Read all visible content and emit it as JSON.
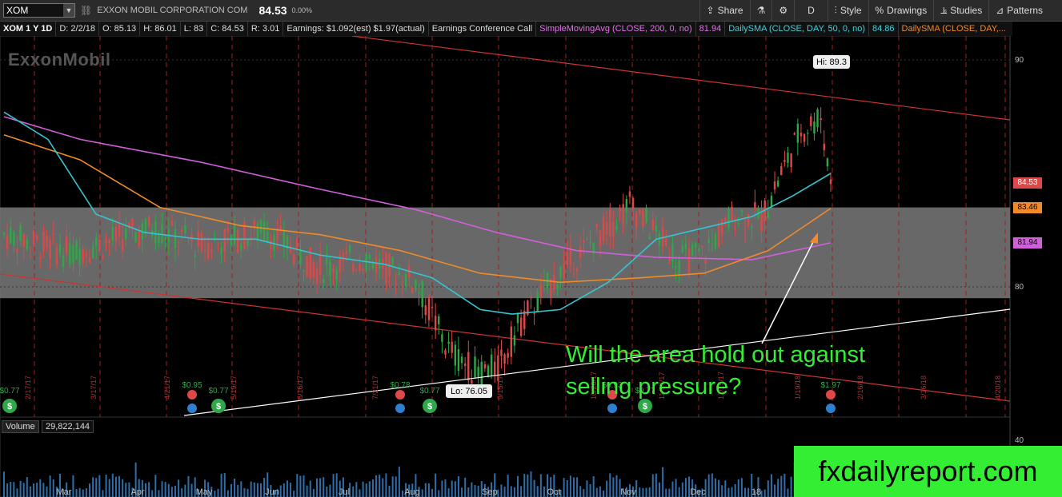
{
  "toolbar": {
    "symbol": "XOM",
    "company": "EXXON MOBIL CORPORATION COM",
    "last_price": "84.53",
    "pct_change": "0.00%",
    "share": "Share",
    "aggregation": "D",
    "style": "Style",
    "drawings": "Drawings",
    "studies": "Studies",
    "patterns": "Patterns"
  },
  "infobar": {
    "title": "XOM 1 Y 1D",
    "date": "D: 2/2/18",
    "open": "O: 85.13",
    "high": "H: 86.01",
    "low": "L: 83",
    "close": "C: 84.53",
    "range": "R: 3.01",
    "earnings": "Earnings: $1.092(est) $1.97(actual)",
    "conf": "Earnings Conference Call",
    "sma200_label": "SimpleMovingAvg (CLOSE, 200, 0, no)",
    "sma200_val": "81.94",
    "sma50_label": "DailySMA (CLOSE, DAY, 50, 0, no)",
    "sma50_val": "84.86",
    "sma100_label": "DailySMA (CLOSE, DAY,..."
  },
  "logo_text": "ExxonMobil",
  "annotation": "Will the area hold out against selling pressure?",
  "watermark": "fxdailyreport.com",
  "volume": {
    "label": "Volume",
    "value": "29,822,144",
    "axis_max": "40"
  },
  "colors": {
    "up": "#2ea84a",
    "down": "#e04848",
    "sma50": "#36c5d0",
    "sma100": "#f08a2a",
    "sma200": "#d060d8",
    "zone": "#7a7a7a",
    "channel": "#cc3333",
    "trendline": "#ffffff",
    "annotation": "#33ee33"
  },
  "chart_data": {
    "type": "candlestick",
    "title": "XOM 1 Y 1D",
    "x_tick_labels": [
      "Mar",
      "Apr",
      "May",
      "Jun",
      "Jul",
      "Aug",
      "Sep",
      "Oct",
      "Nov",
      "Dec",
      "18"
    ],
    "y_tick_labels": [
      "90",
      "80"
    ],
    "ylim": [
      75,
      91
    ],
    "price_labels": {
      "last": "84.53",
      "sma100": "83.46",
      "sma200": "81.94"
    },
    "high_label": "Hi: 89.3",
    "low_label": "Lo: 76.05",
    "high": 89.3,
    "low": 76.05,
    "support_zone": [
      79.5,
      83.5
    ],
    "dividend_labels": [
      "$0.77",
      "$0.77",
      "$0.77",
      "$0.77"
    ],
    "earnings_labels": [
      "$0.95",
      "$0.78",
      "$0.93",
      "$1.97"
    ],
    "date_labels": [
      "2/17/17",
      "3/17/17",
      "4/21/17",
      "5/19/17",
      "6/16/17",
      "7/21/17",
      "9/15/17",
      "10/20/17",
      "11/17/17",
      "12/15/17",
      "1/19/18",
      "2/16/18",
      "3/16/18",
      "4/20/18"
    ],
    "grid": true
  }
}
